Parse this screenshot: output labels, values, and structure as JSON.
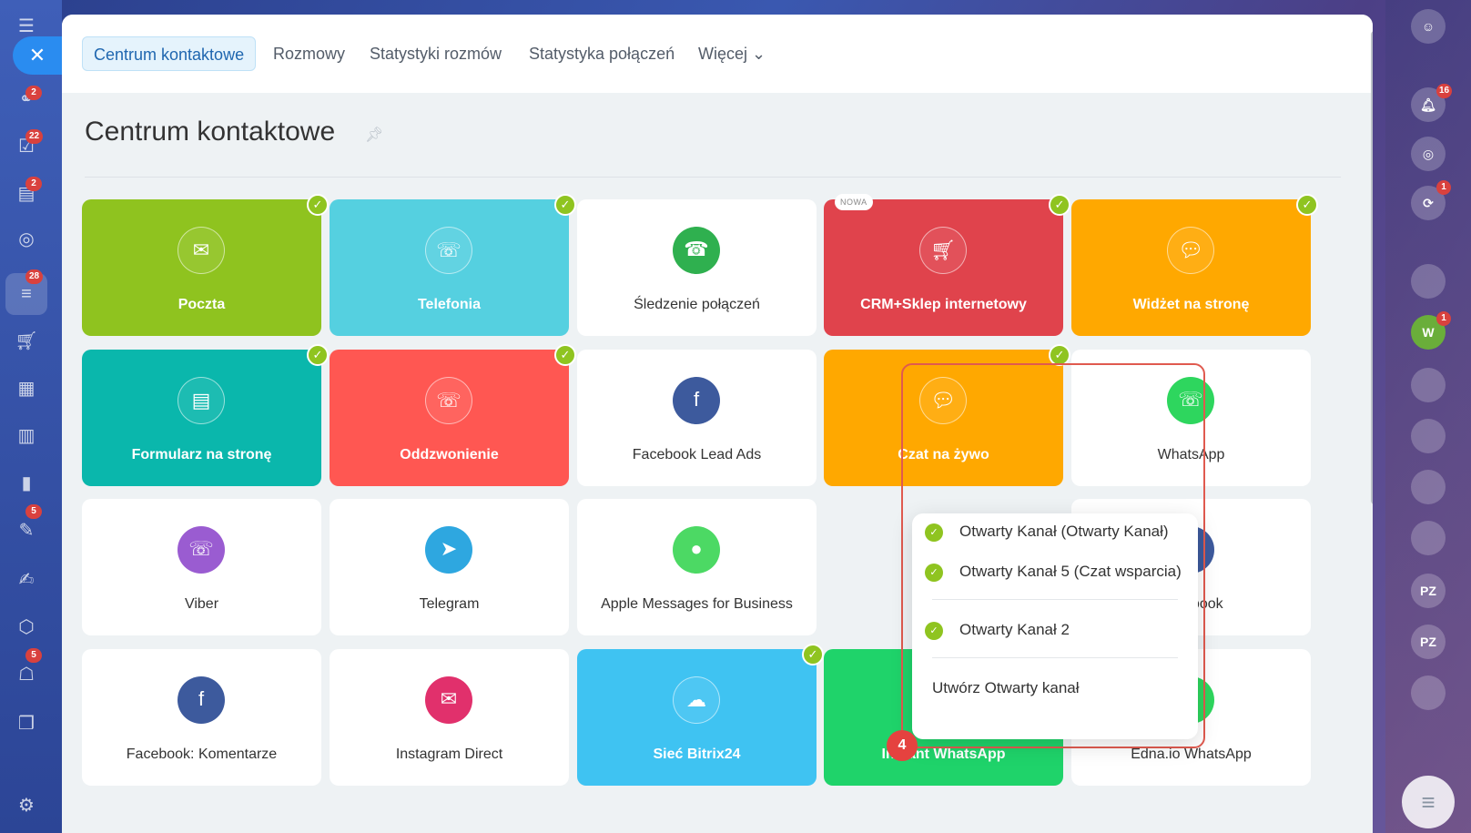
{
  "tabs": [
    {
      "label": "Centrum kontaktowe",
      "active": true
    },
    {
      "label": "Rozmowy"
    },
    {
      "label": "Statystyki rozmów"
    },
    {
      "label": "Statystyka połączeń"
    },
    {
      "label": "Więcej ⌄"
    }
  ],
  "page_title": "Centrum kontaktowe",
  "tiles": [
    {
      "label": "Poczta",
      "color": "#8fc31f",
      "icon": "mail-icon",
      "checked": true
    },
    {
      "label": "Telefonia",
      "color": "#55d0e0",
      "icon": "phone-icon",
      "checked": true
    },
    {
      "label": "Śledzenie połączeń",
      "color": "#ffffff",
      "icon": "call-tracking-icon",
      "icon_color": "#2fb04f"
    },
    {
      "label": "CRM+Sklep internetowy",
      "color": "#e0434c",
      "icon": "shop-cart-icon",
      "checked": true,
      "badge": "NOWA"
    },
    {
      "label": "Widżet na stronę",
      "color": "#ffa800",
      "icon": "chat-widget-icon",
      "checked": true
    },
    {
      "label": "Formularz na stronę",
      "color": "#0ab7ac",
      "icon": "form-icon",
      "checked": true
    },
    {
      "label": "Oddzwonienie",
      "color": "#ff5752",
      "icon": "callback-icon",
      "checked": true
    },
    {
      "label": "Facebook Lead Ads",
      "color": "#ffffff",
      "icon": "facebook-lead-ads-icon",
      "icon_color": "#3d5a9d"
    },
    {
      "label": "Czat na żywo",
      "color": "#ffa800",
      "icon": "live-chat-icon",
      "checked": true
    },
    {
      "label": "WhatsApp",
      "color": "#ffffff",
      "icon": "whatsapp-icon",
      "icon_color": "#2ed65e"
    },
    {
      "label": "Viber",
      "color": "#ffffff",
      "icon": "viber-icon",
      "icon_color": "#9a5cd1"
    },
    {
      "label": "Telegram",
      "color": "#ffffff",
      "icon": "telegram-icon",
      "icon_color": "#2ea7e0"
    },
    {
      "label": "Apple Messages for Business",
      "color": "#ffffff",
      "icon": "apple-messages-icon",
      "icon_color": "#4cd964"
    },
    {
      "label": "",
      "color": "#ffffff",
      "icon": "",
      "hidden": true
    },
    {
      "label": "Facebook",
      "color": "#ffffff",
      "icon": "facebook-icon",
      "icon_color": "#3d5a9d"
    },
    {
      "label": "Facebook: Komentarze",
      "color": "#ffffff",
      "icon": "facebook-comments-icon",
      "icon_color": "#3d5a9d"
    },
    {
      "label": "Instagram Direct",
      "color": "#ffffff",
      "icon": "instagram-direct-icon",
      "icon_color": "#e1306c"
    },
    {
      "label": "Sieć Bitrix24",
      "color": "#3fc3f2",
      "icon": "cloud-icon",
      "checked": true
    },
    {
      "label": "Instant WhatsApp",
      "color": "#1fd36a",
      "icon": "instant-whatsapp-icon"
    },
    {
      "label": "Edna.io WhatsApp",
      "color": "#ffffff",
      "icon": "edna-icon",
      "icon_color": "#2ed65e"
    }
  ],
  "dropdown": {
    "items": [
      {
        "label": "Otwarty Kanał (Otwarty Kanał)",
        "checked": true
      },
      {
        "label": "Otwarty Kanał 5 (Czat wsparcia)",
        "checked": true
      },
      {
        "label": "Otwarty Kanał 2",
        "checked": true
      }
    ],
    "create_label": "Utwórz Otwarty kanał"
  },
  "step_badge": "4",
  "left_rail_badges": [
    "2",
    "22",
    "2",
    "28",
    "5",
    "5"
  ],
  "right_rail": {
    "notifications": "16",
    "sync": "1",
    "avatar_w": "W",
    "w_badge": "1",
    "pz1": "PZ",
    "pz2": "PZ"
  }
}
